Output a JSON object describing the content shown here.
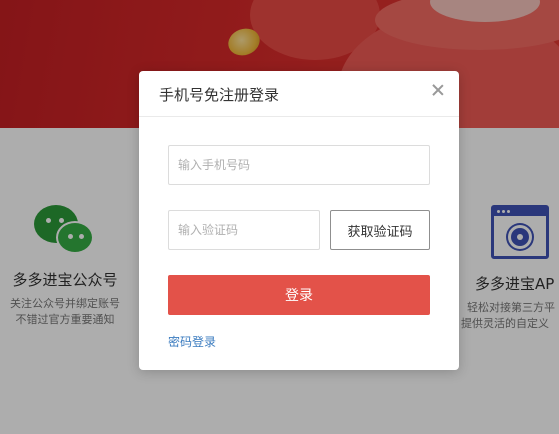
{
  "colors": {
    "accent": "#e35249",
    "link": "#3a7bbf",
    "wechat": "#2b9a38",
    "api_icon": "#3f51b5"
  },
  "background": {
    "wechat": {
      "icon": "wechat-icon",
      "title": "多多进宝公众号",
      "desc_line1": "关注公众号并绑定账号",
      "desc_line2": "不错过官方重要通知"
    },
    "api": {
      "icon": "api-settings-icon",
      "title": "多多进宝AP",
      "desc_line1": "轻松对接第三方平",
      "desc_line2": "提供灵活的自定义"
    }
  },
  "modal": {
    "title": "手机号免注册登录",
    "close_icon": "close-icon",
    "phone_placeholder": "输入手机号码",
    "code_placeholder": "输入验证码",
    "get_code_label": "获取验证码",
    "login_label": "登录",
    "password_login_label": "密码登录"
  }
}
